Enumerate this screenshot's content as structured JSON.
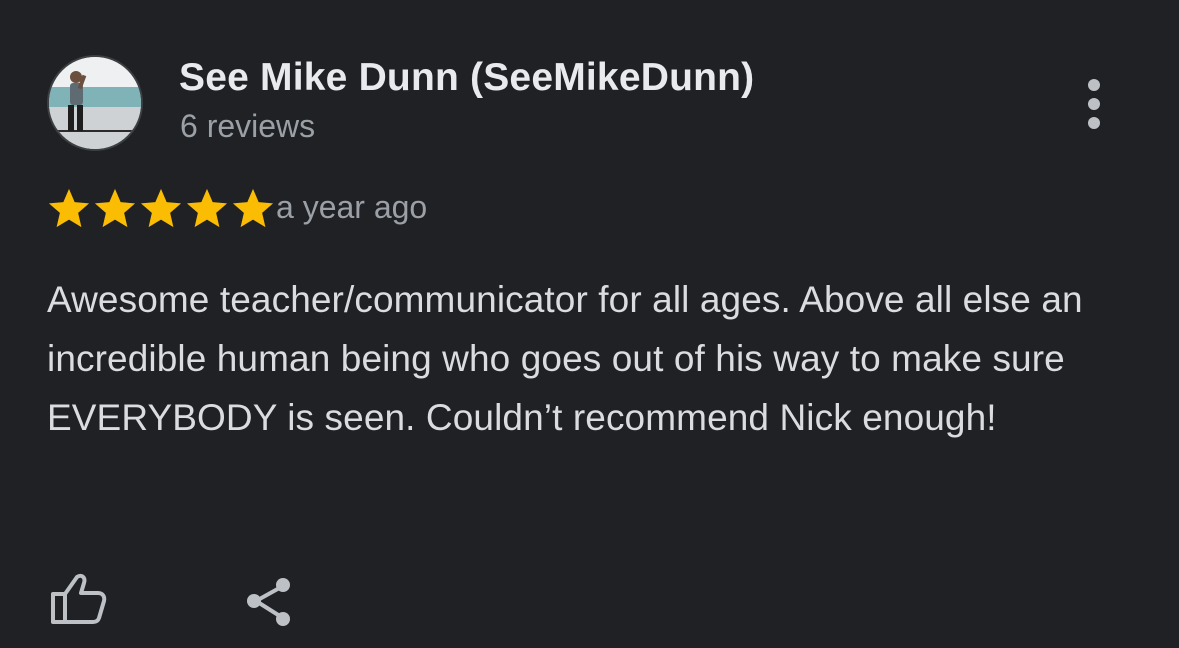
{
  "review": {
    "author_name": "See Mike Dunn (SeeMikeDunn)",
    "review_count": "6 reviews",
    "rating": 5,
    "rating_max": 5,
    "timestamp": "a year ago",
    "text": "Awesome teacher/communicator for all ages. Above all else an incredible human being who goes out of his way to make sure EVERYBODY is seen. Couldn’t recommend Nick enough!"
  },
  "icons": {
    "avatar": "profile-photo",
    "menu": "more-vert-icon",
    "star": "star-icon",
    "like": "thumbs-up-icon",
    "share": "share-icon"
  },
  "colors": {
    "background": "#202124",
    "star": "#fbbc04",
    "primary_text": "#e8eaed",
    "secondary_text": "#9aa0a6",
    "icon": "#bdc1c6"
  }
}
